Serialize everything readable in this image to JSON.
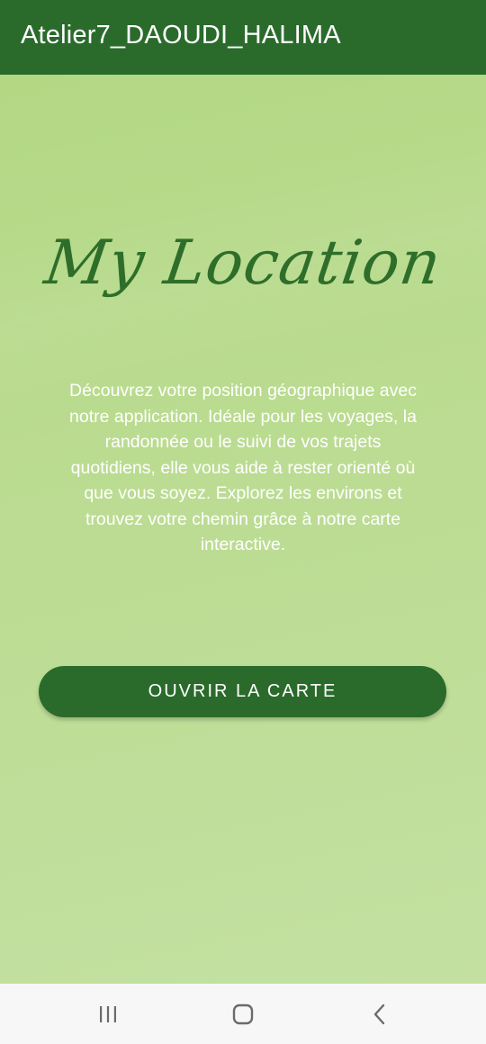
{
  "app_bar": {
    "title": "Atelier7_DAOUDI_HALIMA",
    "background": "#2a6b2c"
  },
  "main": {
    "headline": "My Location",
    "headline_color": "#2e6e2a",
    "description": "Découvrez votre position géographique avec notre application. Idéale pour les voyages, la randonnée ou le suivi de vos trajets quotidiens, elle vous aide à rester orienté où que vous soyez. Explorez les environs et trouvez votre chemin grâce à notre carte interactive.",
    "open_map_button_label": "OUVRIR LA CARTE",
    "background_gradient": [
      "#b3d884",
      "#c3e0a1"
    ]
  },
  "nav_bar": {
    "buttons": [
      {
        "icon": "recent-apps-icon"
      },
      {
        "icon": "home-icon"
      },
      {
        "icon": "back-icon"
      }
    ]
  }
}
